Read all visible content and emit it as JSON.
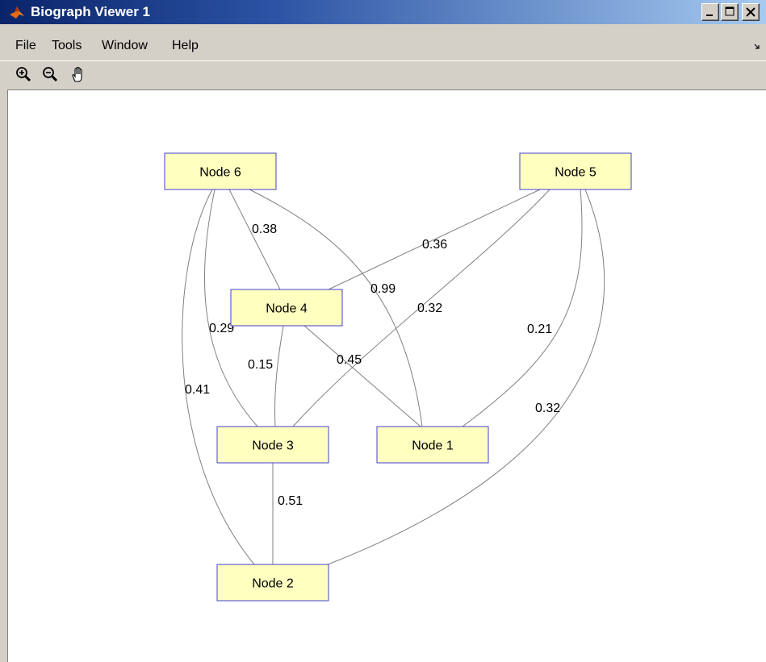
{
  "window": {
    "title": "Biograph Viewer 1",
    "app_icon": "matlab-icon"
  },
  "menu": {
    "items": [
      "File",
      "Tools",
      "Window",
      "Help"
    ]
  },
  "toolbar": {
    "tools": [
      {
        "name": "zoom-in-icon"
      },
      {
        "name": "zoom-out-icon"
      },
      {
        "name": "pan-hand-icon"
      }
    ]
  },
  "graph": {
    "nodes": [
      {
        "id": "node6",
        "label": "Node 6"
      },
      {
        "id": "node5",
        "label": "Node 5"
      },
      {
        "id": "node4",
        "label": "Node 4"
      },
      {
        "id": "node3",
        "label": "Node 3"
      },
      {
        "id": "node1",
        "label": "Node 1"
      },
      {
        "id": "node2",
        "label": "Node 2"
      }
    ],
    "edges": [
      {
        "from": "node6",
        "to": "node4",
        "weight": "0.38"
      },
      {
        "from": "node6",
        "to": "node1",
        "weight": "0.99"
      },
      {
        "from": "node6",
        "to": "node3",
        "weight": "0.29"
      },
      {
        "from": "node6",
        "to": "node2",
        "weight": "0.41"
      },
      {
        "from": "node5",
        "to": "node4",
        "weight": "0.36"
      },
      {
        "from": "node5",
        "to": "node3",
        "weight": "0.32"
      },
      {
        "from": "node5",
        "to": "node1",
        "weight": "0.21"
      },
      {
        "from": "node5",
        "to": "node2",
        "weight": "0.32"
      },
      {
        "from": "node4",
        "to": "node3",
        "weight": "0.15"
      },
      {
        "from": "node4",
        "to": "node1",
        "weight": "0.45"
      },
      {
        "from": "node3",
        "to": "node2",
        "weight": "0.51"
      }
    ],
    "node_fill": "#ffffc0",
    "node_stroke": "#4040d0",
    "edge_color": "#808080"
  }
}
